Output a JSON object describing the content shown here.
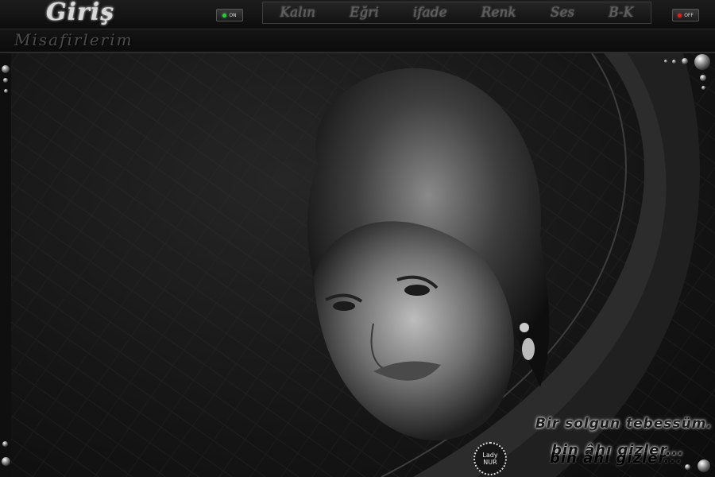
{
  "header": {
    "logo_text": "Giriş",
    "subtitle": "Misafirlerim"
  },
  "toggles": {
    "on_label": "ON",
    "off_label": "OFF"
  },
  "toolbar": {
    "items": [
      "Kalın",
      "Eğri",
      "ifade",
      "Renk",
      "Ses",
      "B-K"
    ]
  },
  "caption": {
    "line1": "Bir solgun tebessüm.",
    "line2": "bin âhı gizler...",
    "line2_shadow": "bin âhı gizler..."
  },
  "signature": {
    "line1": "Lady",
    "line2": "NUR"
  },
  "colors": {
    "on_led": "#2ecc40",
    "off_led": "#e02020",
    "background": "#0a0a0a"
  }
}
